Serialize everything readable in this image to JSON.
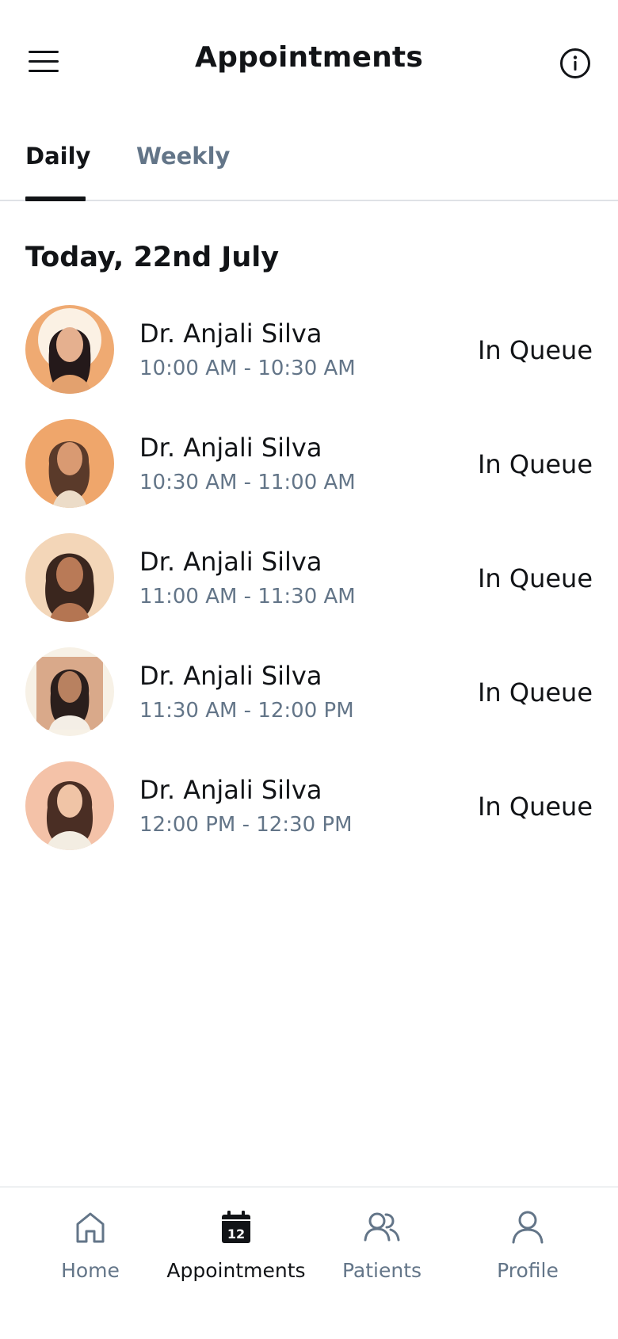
{
  "header": {
    "title": "Appointments"
  },
  "tabs": [
    {
      "label": "Daily",
      "active": true
    },
    {
      "label": "Weekly",
      "active": false
    }
  ],
  "section": {
    "title": "Today, 22nd July"
  },
  "appointments": [
    {
      "name": "Dr. Anjali Silva",
      "time": "10:00 AM - 10:30 AM",
      "status": "In Queue"
    },
    {
      "name": "Dr. Anjali Silva",
      "time": "10:30 AM - 11:00 AM",
      "status": "In Queue"
    },
    {
      "name": "Dr. Anjali Silva",
      "time": "11:00 AM - 11:30 AM",
      "status": "In Queue"
    },
    {
      "name": "Dr. Anjali Silva",
      "time": "11:30 AM - 12:00 PM",
      "status": "In Queue"
    },
    {
      "name": "Dr. Anjali Silva",
      "time": "12:00 PM - 12:30 PM",
      "status": "In Queue"
    }
  ],
  "nav": [
    {
      "label": "Home",
      "icon": "home-icon",
      "active": false
    },
    {
      "label": "Appointments",
      "icon": "calendar-icon",
      "active": true,
      "badge": "12"
    },
    {
      "label": "Patients",
      "icon": "users-icon",
      "active": false
    },
    {
      "label": "Profile",
      "icon": "user-icon",
      "active": false
    }
  ],
  "colors": {
    "text": "#121417",
    "muted": "#637588",
    "divider": "#dfe2e6"
  }
}
